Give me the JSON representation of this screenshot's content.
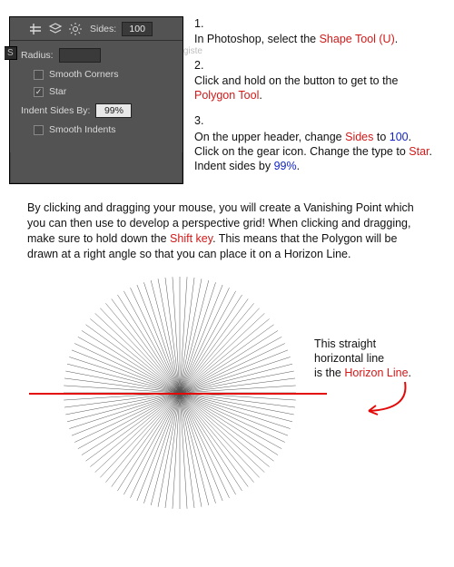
{
  "panel": {
    "sides_label": "Sides:",
    "sides_value": "100",
    "edge_left": "S",
    "edge_right": "giste",
    "radius_label": "Radius:",
    "smooth_corners": "Smooth Corners",
    "star": "Star",
    "indent_label": "Indent Sides By:",
    "indent_value": "99%",
    "smooth_indents": "Smooth Indents",
    "star_checked": "✓"
  },
  "steps": [
    {
      "num": "1.",
      "pre": "In Photoshop, select the ",
      "hl1": "Shape Tool (U)",
      "hl1_class": "r",
      "post": "."
    },
    {
      "num": "2.",
      "pre": "Click and hold on the button to get to the ",
      "hl1": "Polygon Tool",
      "hl1_class": "r",
      "post": "."
    },
    {
      "num": "3.",
      "pre": "On the upper header, change ",
      "hl1": "Sides",
      "hl1_class": "r",
      "mid1": " to ",
      "hl2": "100",
      "hl2_class": "b",
      "mid2": ". Click on the gear icon. Change the type to ",
      "hl3": "Star",
      "hl3_class": "r",
      "mid3": ". Indent sides by ",
      "hl4": "99%",
      "hl4_class": "b",
      "post": "."
    }
  ],
  "paragraph": {
    "pre": "By clicking and dragging your mouse, you will create a Vanishing Point which you can then use to develop a perspective grid! When clicking and dragging, make sure to hold down the ",
    "hl": "Shift key",
    "post": ". This means that the Polygon will be drawn at a right angle so that you can place it on a Horizon Line."
  },
  "caption": {
    "l1": "This straight",
    "l2": "horizontal line",
    "l3_pre": "is the ",
    "l3_hl": "Horizon Line",
    "l3_post": "."
  },
  "chart_data": {
    "type": "diagram",
    "description": "Radial star burst (100-side, 99% indented star) forming a vanishing point, with a single red horizontal line through its center labeled Horizon Line.",
    "spokes": 100,
    "indent_percent": 99,
    "horizon_line_color": "#e30909"
  }
}
